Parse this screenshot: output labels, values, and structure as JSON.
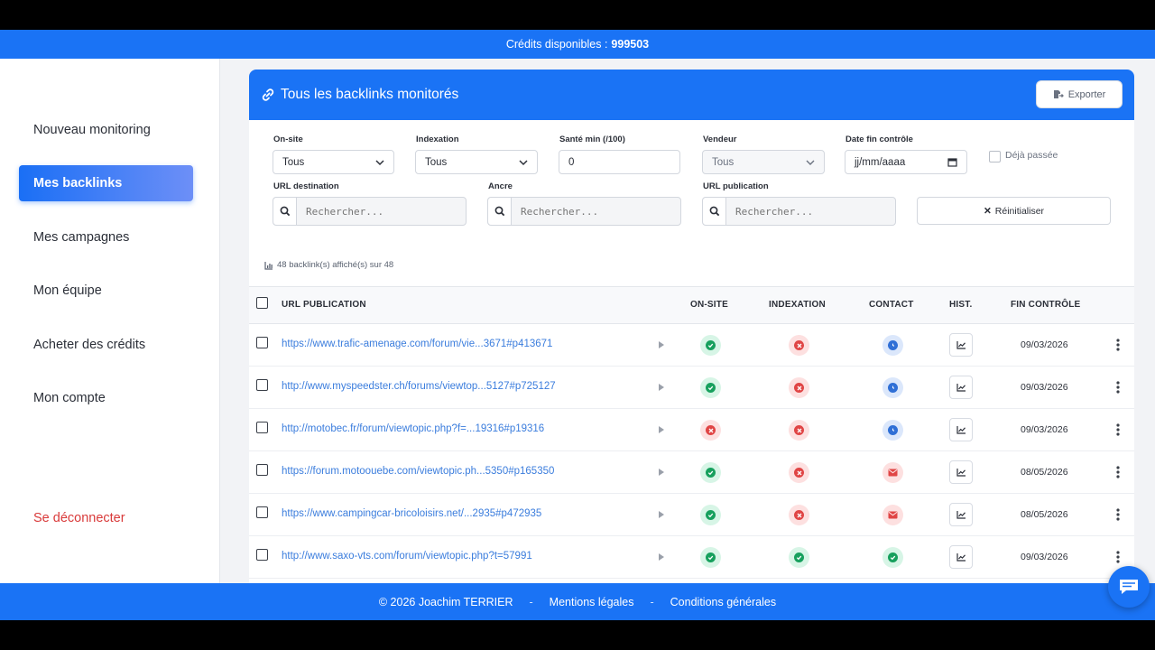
{
  "credits": {
    "label": "Crédits disponibles :",
    "value": "999503"
  },
  "sidebar": {
    "items": [
      {
        "label": "Nouveau monitoring"
      },
      {
        "label": "Mes backlinks"
      },
      {
        "label": "Mes campagnes"
      },
      {
        "label": "Mon équipe"
      },
      {
        "label": "Acheter des crédits"
      },
      {
        "label": "Mon compte"
      }
    ],
    "logout": "Se déconnecter",
    "active": "Mes backlinks"
  },
  "card": {
    "title": "Tous les backlinks monitorés",
    "export_label": "Exporter"
  },
  "filters": {
    "onsite": {
      "label": "On-site",
      "value": "Tous"
    },
    "indexation": {
      "label": "Indexation",
      "value": "Tous"
    },
    "sante": {
      "label": "Santé min (/100)",
      "value": "0"
    },
    "vendeur": {
      "label": "Vendeur",
      "value": "Tous"
    },
    "date_fin": {
      "label": "Date fin contrôle",
      "value": "jj/mm/aaaa"
    },
    "deja_passee": "Déjà passée",
    "url_destination": {
      "label": "URL destination",
      "placeholder": "Rechercher..."
    },
    "ancre": {
      "label": "Ancre",
      "placeholder": "Rechercher..."
    },
    "url_publication": {
      "label": "URL publication",
      "placeholder": "Rechercher..."
    },
    "reset_label": "Réinitialiser"
  },
  "count_text": "48 backlink(s) affiché(s) sur 48",
  "table": {
    "headers": {
      "url": "URL PUBLICATION",
      "onsite": "ON-SITE",
      "indexation": "INDEXATION",
      "contact": "CONTACT",
      "hist": "HIST.",
      "fin": "FIN CONTRÔLE"
    },
    "rows": [
      {
        "url": "https://www.trafic-amenage.com/forum/vie...3671#p413671",
        "onsite": "ok",
        "indexation": "ko",
        "contact": "pending",
        "date": "09/03/2026"
      },
      {
        "url": "http://www.myspeedster.ch/forums/viewtop...5127#p725127",
        "onsite": "ok",
        "indexation": "ko",
        "contact": "pending",
        "date": "09/03/2026"
      },
      {
        "url": "http://motobec.fr/forum/viewtopic.php?f=...19316#p19316",
        "onsite": "ko",
        "indexation": "ko",
        "contact": "pending",
        "date": "09/03/2026"
      },
      {
        "url": "https://forum.motoouebe.com/viewtopic.ph...5350#p165350",
        "onsite": "ok",
        "indexation": "ko",
        "contact": "mail",
        "date": "08/05/2026"
      },
      {
        "url": "https://www.campingcar-bricoloisirs.net/...2935#p472935",
        "onsite": "ok",
        "indexation": "ko",
        "contact": "mail",
        "date": "08/05/2026"
      },
      {
        "url": "http://www.saxo-vts.com/forum/viewtopic.php?t=57991",
        "onsite": "ok",
        "indexation": "ok",
        "contact": "ok",
        "date": "09/03/2026"
      }
    ]
  },
  "footer": {
    "copyright": "© 2026 Joachim TERRIER",
    "sep": "-",
    "mentions": "Mentions légales",
    "conditions": "Conditions générales"
  },
  "colors": {
    "primary": "#1a73f5",
    "ok": "#17a05d",
    "ko": "#e04545",
    "pending": "#2f6fd6",
    "logout": "#d93a3a"
  }
}
